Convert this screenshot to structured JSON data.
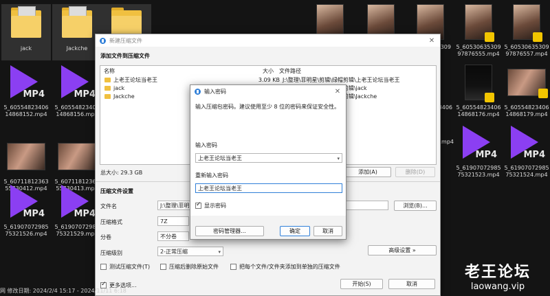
{
  "desktop": {
    "tiles": [
      {
        "kind": "folder",
        "caption": "jack"
      },
      {
        "kind": "folder",
        "caption": "Jackche"
      },
      {
        "kind": "folder",
        "caption": ""
      },
      {
        "kind": "mp4",
        "caption": "5_60554823406 14868152.mp4"
      },
      {
        "kind": "mp4",
        "caption": "5_60554823406 14868156.mp4"
      },
      {
        "kind": "photo",
        "caption": "5_60711812363 55730412.mp4"
      },
      {
        "kind": "photo",
        "caption": "5_60711812363 55730413.mp4"
      },
      {
        "kind": "mp4",
        "caption": "5_61907072985 75321526.mp4"
      },
      {
        "kind": "mp4",
        "caption": "5_61907072985 75321529.mp4"
      },
      {
        "kind": "photo",
        "caption": ""
      },
      {
        "kind": "photo",
        "caption": ""
      },
      {
        "kind": "photo",
        "caption": ""
      },
      {
        "kind": "photo",
        "caption": "5_60530635309 97876555.mp4"
      },
      {
        "kind": "photo",
        "caption": "5_60530635309 97876557.mp4"
      },
      {
        "kind": "photo",
        "caption": "5_60554823406 14868176.mp4"
      },
      {
        "kind": "photo",
        "caption": "5_60554823406 14868179.mp4"
      },
      {
        "kind": "mp4",
        "caption": "5_61907072985 75321523.mp4"
      },
      {
        "kind": "mp4",
        "caption": "5_61907072985 75321524.mp4"
      }
    ],
    "mp4_label": "MP4",
    "partial_caption_309": "309",
    "partial_caption_3406": "3406",
    "partial_caption_76mp4": "76.mp4"
  },
  "archive_dialog": {
    "title": "新建压缩文件",
    "add_section": "添加文件到压缩文件",
    "columns": {
      "name": "名称",
      "size": "大小",
      "path": "文件路径"
    },
    "rows": [
      {
        "name": "上老王论坛当老王",
        "size": "3.09 KB",
        "path": "J:\\整理\\菲明星\\剪辑\\绿帽剪辑\\上老王论坛当老王"
      },
      {
        "name": "jack",
        "size": "",
        "path": "J:\\整理\\菲明星\\剪辑\\绿帽剪辑\\jack"
      },
      {
        "name": "Jackche",
        "size": "",
        "path": "J:\\整理\\菲明星\\剪辑\\绿帽剪辑\\Jackche"
      }
    ],
    "total_size": "总大小: 29.3 GB",
    "add_button": "添加(A)",
    "delete_button": "删除(D)",
    "settings_section": "压缩文件设置",
    "filename_label": "文件名",
    "filename_value": "J:\\整理\\菲明星",
    "browse_button": "浏览(B)...",
    "format_label": "压缩格式",
    "format_value": "7Z",
    "split_label": "分卷",
    "split_value": "不分卷",
    "level_label": "压缩级别",
    "level_value": "2-正常压缩",
    "advanced_button": "高级设置 »",
    "test_check": "测试压缩文件(T)",
    "delete_after_check": "压缩后删除原始文件",
    "separate_check": "把每个文件/文件夹添加到单独的压缩文件",
    "more_options_check": "更多选项...",
    "start_button": "开始(S)",
    "cancel_button": "取消"
  },
  "password_dialog": {
    "title": "输入密码",
    "hint": "输入压缩包密码。建议使用至少 8 位的密码来保证安全性。",
    "enter_label": "输入密码",
    "enter_value": "上老王论坛当老王",
    "reenter_label": "重新输入密码",
    "reenter_value": "上老王论坛当老王",
    "show_password": "显示密码",
    "manager_button": "密码管理器...",
    "ok_button": "确定",
    "cancel_button": "取消"
  },
  "statusbar": {
    "text": "网 修改日期:    2024/2/4 15:17 - 2024/11/11 6:18"
  },
  "watermark": {
    "line1": "老王论坛",
    "line2": "laowang.vip"
  },
  "colors": {
    "mp4_accent": "#8b3ff2",
    "primary_blue": "#2f7fd8",
    "folder_yellow": "#f0c040"
  }
}
